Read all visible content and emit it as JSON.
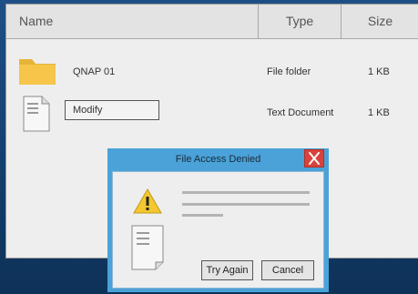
{
  "columns": {
    "name": "Name",
    "type": "Type",
    "size": "Size"
  },
  "files": [
    {
      "name": "QNAP 01",
      "type": "File folder",
      "size": "1  KB",
      "icon": "folder-icon"
    },
    {
      "name": "Modify",
      "type": "Text Document",
      "size": "1  KB",
      "icon": "document-icon"
    }
  ],
  "dialog": {
    "title": "File Access Denied",
    "try_again_label": "Try Again",
    "cancel_label": "Cancel",
    "icons": [
      "warning-icon",
      "document-icon",
      "close-icon"
    ]
  },
  "colors": {
    "desktop": "#1d4f86",
    "dialog_frame": "#4aa2d8",
    "close_button": "#d9433b",
    "folder": "#f6c549",
    "warning": "#f3c72f"
  }
}
